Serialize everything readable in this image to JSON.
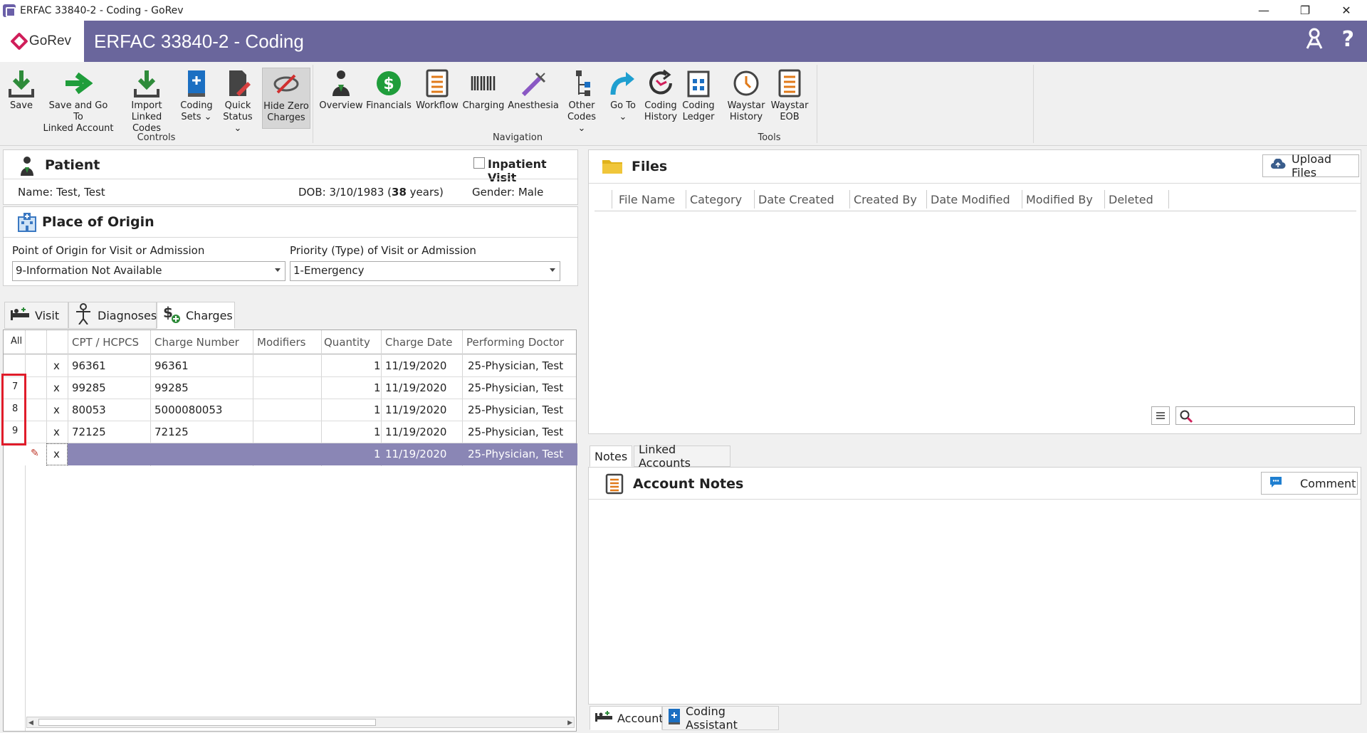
{
  "window": {
    "title": "ERFAC 33840-2 - Coding - GoRev",
    "minimize": "—",
    "restore": "❐",
    "close": "✕"
  },
  "header": {
    "logo_text": "GoRev",
    "page_title": "ERFAC 33840-2 - Coding",
    "help_icon": "?"
  },
  "ribbon": {
    "groups": {
      "controls": "Controls",
      "navigation": "Navigation",
      "tools": "Tools"
    },
    "buttons": {
      "save": [
        "Save",
        ""
      ],
      "save_go": [
        "Save and Go To",
        "Linked Account"
      ],
      "import": [
        "Import",
        "Linked Codes"
      ],
      "coding_sets": [
        "Coding",
        "Sets ⌄"
      ],
      "quick_status": [
        "Quick",
        "Status ⌄"
      ],
      "hide_zero": [
        "Hide Zero",
        "Charges"
      ],
      "overview": [
        "Overview",
        ""
      ],
      "financials": [
        "Financials",
        ""
      ],
      "workflow": [
        "Workflow",
        ""
      ],
      "charging": [
        "Charging",
        ""
      ],
      "anesthesia": [
        "Anesthesia",
        ""
      ],
      "other_codes": [
        "Other",
        "Codes ⌄"
      ],
      "go_to": [
        "Go To",
        "⌄"
      ],
      "coding_history": [
        "Coding",
        "History"
      ],
      "coding_ledger": [
        "Coding",
        "Ledger"
      ],
      "waystar_history": [
        "Waystar",
        "History"
      ],
      "waystar_eob": [
        "Waystar",
        "EOB"
      ]
    }
  },
  "patient": {
    "title": "Patient",
    "inpatient_label": "Inpatient Visit",
    "name": "Name: Test, Test",
    "dob_prefix": "DOB: 3/10/1983 (",
    "age": "38",
    "dob_suffix": " years)",
    "gender": "Gender: Male"
  },
  "origin": {
    "title": "Place of Origin",
    "point_label": "Point of Origin for Visit or Admission",
    "point_value": "9-Information Not Available",
    "priority_label": "Priority (Type) of Visit or Admission",
    "priority_value": "1-Emergency"
  },
  "tabs": {
    "visit": "Visit",
    "diagnoses": "Diagnoses",
    "charges": "Charges"
  },
  "grid": {
    "all_label": "All",
    "headers": [
      "CPT / HCPCS",
      "Charge Number",
      "Modifiers",
      "Quantity",
      "Charge Date",
      "Performing Doctor"
    ],
    "rows": [
      {
        "num": "",
        "x": "x",
        "cpt": "96361",
        "charge": "96361",
        "mod": "",
        "qty": "1",
        "date": "11/19/2020",
        "doctor": "25-Physician, Test"
      },
      {
        "num": "7",
        "x": "x",
        "cpt": "99285",
        "charge": "99285",
        "mod": "",
        "qty": "1",
        "date": "11/19/2020",
        "doctor": "25-Physician, Test"
      },
      {
        "num": "8",
        "x": "x",
        "cpt": "80053",
        "charge": "5000080053",
        "mod": "",
        "qty": "1",
        "date": "11/19/2020",
        "doctor": "25-Physician, Test"
      },
      {
        "num": "9",
        "x": "x",
        "cpt": "72125",
        "charge": "72125",
        "mod": "",
        "qty": "1",
        "date": "11/19/2020",
        "doctor": "25-Physician, Test"
      },
      {
        "num": "",
        "x": "x",
        "cpt": "",
        "charge": "",
        "mod": "",
        "qty": "1",
        "date": "11/19/2020",
        "doctor": "25-Physician, Test"
      }
    ]
  },
  "files": {
    "title": "Files",
    "upload_label": "Upload Files",
    "headers": [
      "File Name",
      "Category",
      "Date Created",
      "Created By",
      "Date Modified",
      "Modified By",
      "Deleted"
    ]
  },
  "notes": {
    "tab_notes": "Notes",
    "tab_linked": "Linked Accounts",
    "title": "Account Notes",
    "comment_label": "Comment"
  },
  "bottom_tabs": {
    "account": "Account",
    "coding_assistant": "Coding Assistant"
  }
}
